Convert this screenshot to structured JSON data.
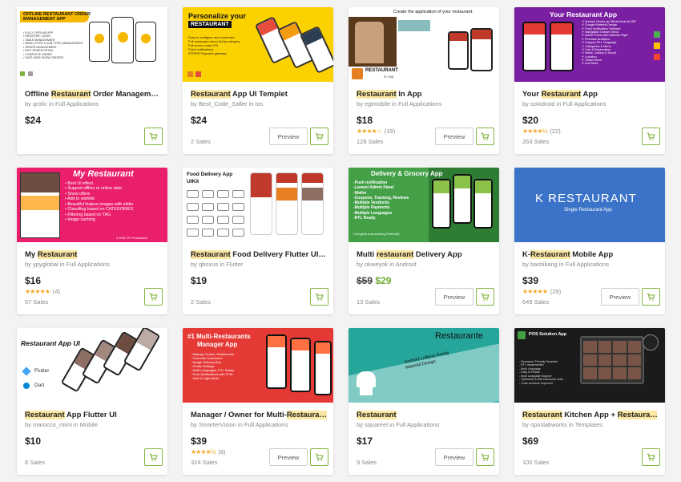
{
  "colors": {
    "accent": "#82b540",
    "star": "#f3a722",
    "sale_price": "#6ea82d",
    "highlight": "#fbe7a1"
  },
  "preview_label": "Preview",
  "cards": [
    {
      "title_pre": "Offline ",
      "title_hl": "Restaurant",
      "title_post": " Order Management ...",
      "author": "qrolic",
      "category": "Full Applications",
      "price": "$24",
      "rating": "",
      "reviews": "",
      "sales": "",
      "has_preview": false,
      "thumb": {
        "heading": "OFFLINE RESTAURANT ORDER MANAGEMENT APP",
        "bullets": "• FULLY OFFLINE APP\n• REGISTER, LOGIN\n• TABLE MANAGEMENT\n• MENU (TYPE & SUB-TYPE) MANAGEMENT\n• ORDER MANAGEMENT\n• EDIT ORDER DETAIL\n• COMPLETE ORDER\n• DATE WISE SHOW ORDERS"
      }
    },
    {
      "title_pre": "",
      "title_hl": "Restaurant",
      "title_post": " App UI Templet",
      "author": "Best_Code_Saller",
      "category": "Ios",
      "price": "$24",
      "rating": "",
      "reviews": "",
      "sales": "2 Sales",
      "has_preview": true,
      "thumb": {
        "heading": "Personalize your",
        "heading2": "RESTAURANT",
        "bullets": "Easy to configure and customize\nFull restaurant menu list by category\nFull source code iOS\nPush notifications\nSTRIPE Payment gateway"
      }
    },
    {
      "title_pre": "",
      "title_hl": "Restaurant",
      "title_post": " In App",
      "author": "egimobile",
      "category": "Full Applications",
      "price": "$18",
      "rating": "★★★★☆",
      "reviews": "(19)",
      "sales": "128 Sales",
      "has_preview": true,
      "thumb": {
        "heading": "Create the application of your restaurant.",
        "logo": "RESTAURANT",
        "logo_sub": "in App"
      }
    },
    {
      "title_pre": "Your ",
      "title_hl": "Restaurant",
      "title_post": " App",
      "author": "solodroid",
      "category": "Full Applications",
      "price": "$20",
      "rating": "★★★★½",
      "reviews": "(22)",
      "sales": "263 Sales",
      "has_preview": false,
      "thumb": {
        "heading": "Your Restaurant App",
        "bullets": "✔ Android Studio as Official Android IDE\n✔ Google Material Design\n✔ Push Notification Firebase\n✔ Navigation Drawer Menu\n✔ Admin Panel with Material Style\n✔ Firebase Analytics\n✔ Support RTL Language\n✔ Categories & Menu\n✔ Cart & Reservation\n✔ News, Gallery & Social\n✔ Location\n✔ Share Menu\n✔ And More"
      }
    },
    {
      "title_pre": "My ",
      "title_hl": "Restaurant",
      "title_post": "",
      "author": "ypyglobal",
      "category": "Full Applications",
      "price": "$16",
      "rating": "★★★★★",
      "reviews": "(4)",
      "sales": "57 Sales",
      "has_preview": false,
      "thumb": {
        "heading": "My Restaurant",
        "bullets": "• Best UI effect\n• Support offline or online data\n• Show offers\n• Add to wishlist\n• Beautiful feature images with slider\n• Classifing based on CATEGORIES\n• Filtering based on TAG\n• Image caching",
        "footer": "© 2015 YPY Productions"
      }
    },
    {
      "title_pre": "",
      "title_hl": "Restaurant",
      "title_post": " Food Delivery Flutter UIKit",
      "author": "qboxus",
      "category": "Flutter",
      "price": "$19",
      "rating": "",
      "reviews": "",
      "sales": "2 Sales",
      "has_preview": false,
      "thumb": {
        "heading": "Food Delivery App",
        "heading2": "UIKit"
      }
    },
    {
      "title_pre": "Multi ",
      "title_hl": "restaurant",
      "title_post": " Delivery App",
      "author": "okweyok",
      "category": "Android",
      "price_old": "$59",
      "price": "$29",
      "rating": "",
      "reviews": "",
      "sales": "13 Sales",
      "has_preview": true,
      "thumb": {
        "heading": "Delivery & Grocery App",
        "bullets": "-Push notification\n-Laravel Admin Panel\n-Wallet\n-Coupons, Tracking, Reviews\n-Multiple Vendords\n-Multiple Payments\n-Multiple Languages\n-RTL Ready",
        "footer": "Complete and working Perfectly!"
      }
    },
    {
      "title_pre": "K-",
      "title_hl": "Restaurant",
      "title_post": " Mobile App",
      "author": "bastiikang",
      "category": "Full Applications",
      "price": "$39",
      "rating": "★★★★★",
      "reviews": "(29)",
      "sales": "649 Sales",
      "has_preview": true,
      "thumb": {
        "heading": "K RESTAURANT",
        "heading2": "Single Restaurant App"
      }
    },
    {
      "title_pre": "",
      "title_hl": "Restaurant",
      "title_post": " App Flutter UI",
      "author": "marocco_mimi",
      "category": "Mobile",
      "price": "$10",
      "rating": "",
      "reviews": "",
      "sales": "8 Sales",
      "has_preview": false,
      "thumb": {
        "heading": "Restaurant App UI",
        "tag1": "Flutter",
        "tag2": "Dart"
      }
    },
    {
      "title_pre": "Manager / Owner for Multi-",
      "title_hl": "Restaurants",
      "title_post": "...",
      "author": "SmarterVision",
      "category": "Full Applications",
      "price": "$39",
      "rating": "★★★★½",
      "reviews": "(8)",
      "sales": "324 Sales",
      "has_preview": true,
      "thumb": {
        "heading": "#1 Multi-Restaurants",
        "heading2": "Manager App",
        "bullets": "- Manage Orders, Restaurants\n- Chat with Customers\n- Assign Delivery Boy\n- Profile Settings\n- Multi-Languages, RTL Ready\n- Push Notifications with FCM\n- Dark & Light Mode"
      }
    },
    {
      "title_pre": "",
      "title_hl": "Restaurant",
      "title_post": "",
      "author": "squareet",
      "category": "Full Applications",
      "price": "$17",
      "rating": "",
      "reviews": "",
      "sales": "9 Sales",
      "has_preview": true,
      "thumb": {
        "heading": "Restaurante",
        "heading2": "Android Lollipop Ready\nMaterial Design"
      }
    },
    {
      "title_pre": "",
      "title_hl": "Restaurant",
      "title_post": " Kitchen App + ",
      "title_hl2": "Restaurant",
      "title_post2": " ...",
      "author": "opuslabworks",
      "category": "Templates",
      "price": "$69",
      "rating": "",
      "reviews": "",
      "sales": "100 Sales",
      "has_preview": false,
      "thumb": {
        "heading": "POS Solution App",
        "bullets": "- Developer Friendly Template\n- RTL Implemented\n- Multi Language\n- Easy to Reskin\n- Multi Language Support\n- Optimized & well structured code\n- Code structure Improved"
      }
    }
  ]
}
